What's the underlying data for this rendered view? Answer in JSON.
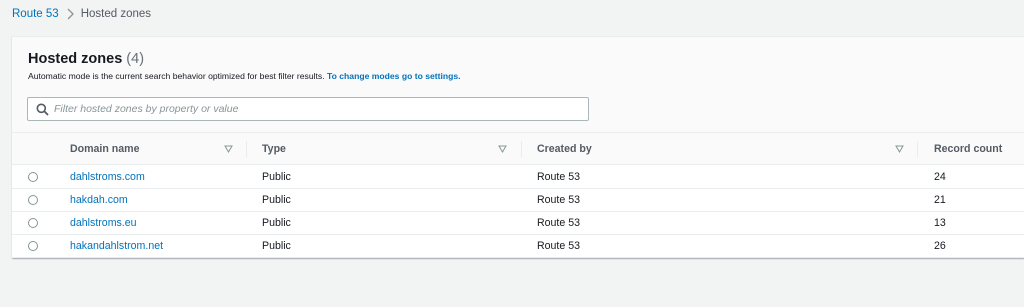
{
  "breadcrumb": {
    "root": "Route 53",
    "current": "Hosted zones"
  },
  "panel": {
    "title": "Hosted zones",
    "count": "(4)",
    "description": "Automatic mode is the current search behavior optimized for best filter results.",
    "description_link": "To change modes go to settings."
  },
  "search": {
    "placeholder": "Filter hosted zones by property or value",
    "value": ""
  },
  "table": {
    "columns": [
      "Domain name",
      "Type",
      "Created by",
      "Record count"
    ],
    "rows": [
      {
        "domain": "dahlstroms.com",
        "type": "Public",
        "created_by": "Route 53",
        "record_count": "24"
      },
      {
        "domain": "hakdah.com",
        "type": "Public",
        "created_by": "Route 53",
        "record_count": "21"
      },
      {
        "domain": "dahlstroms.eu",
        "type": "Public",
        "created_by": "Route 53",
        "record_count": "13"
      },
      {
        "domain": "hakandahlstrom.net",
        "type": "Public",
        "created_by": "Route 53",
        "record_count": "26"
      }
    ]
  },
  "icons": {
    "breadcrumb_separator": "chevron-right-icon",
    "search": "search-icon",
    "sort": "sort-descending-icon",
    "row_select": "radio-button"
  },
  "colors": {
    "link": "#0073bb",
    "background": "#f2f3f3",
    "header_background": "#fafafa"
  }
}
